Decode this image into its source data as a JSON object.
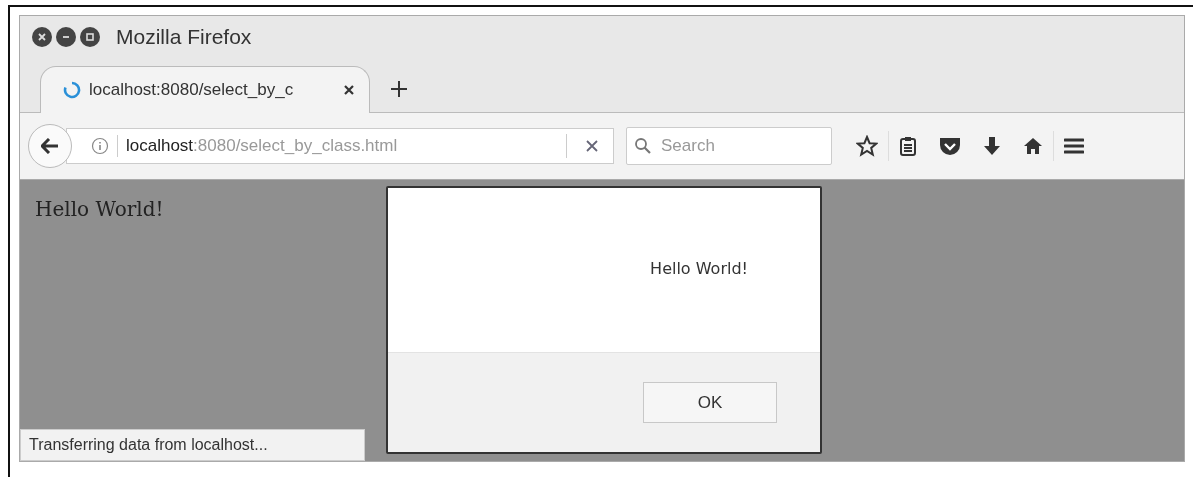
{
  "window": {
    "title": "Mozilla Firefox"
  },
  "tabs": [
    {
      "title": "localhost:8080/select_by_c",
      "selected": true,
      "loading": true
    }
  ],
  "address_bar": {
    "host": "localhost",
    "path": ":8080/select_by_class.html"
  },
  "search": {
    "placeholder": "Search"
  },
  "page": {
    "text": "Hello World!"
  },
  "dialog": {
    "message": "Hello World!",
    "buttons": [
      "OK"
    ]
  },
  "status_bar": "Transferring data from localhost..."
}
